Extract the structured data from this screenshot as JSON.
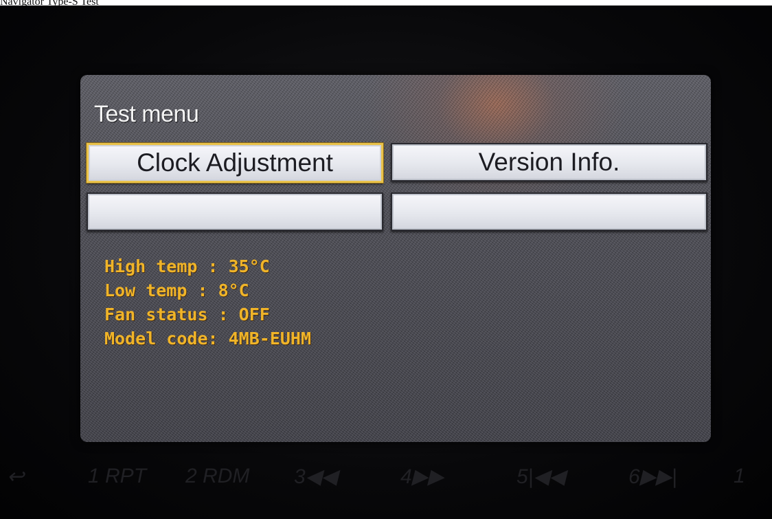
{
  "caption": "Navigator Type-S Test",
  "screen": {
    "title": "Test menu",
    "buttons": [
      {
        "label": "Clock Adjustment",
        "selected": true
      },
      {
        "label": "Version Info.",
        "selected": false
      },
      {
        "label": "",
        "selected": false
      },
      {
        "label": "",
        "selected": false
      }
    ],
    "info": [
      "High temp : 35°C",
      "Low temp : 8°C",
      "Fan status : OFF",
      "Model code: 4MB-EUHM"
    ]
  },
  "hardware_buttons": [
    "↩",
    "1 RPT",
    "2 RDM",
    "3◀◀",
    "4▶▶",
    "5|◀◀",
    "6▶▶|",
    "1"
  ],
  "colors": {
    "info_text": "#f0b428",
    "selection_border": "#e9c24a",
    "button_face": "#e6e8ee",
    "screen_bg": "#4a4a52"
  }
}
